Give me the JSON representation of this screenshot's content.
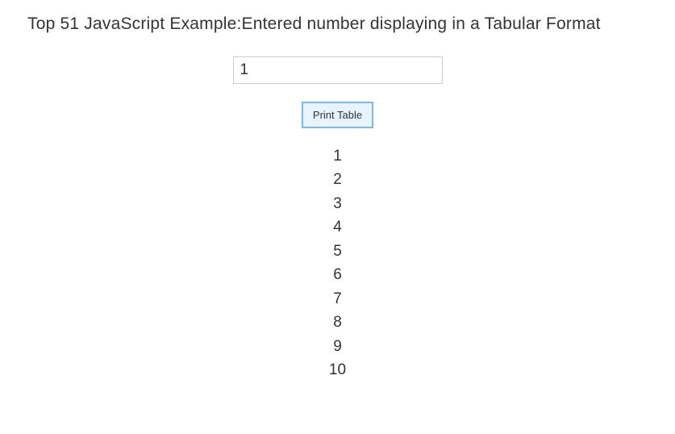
{
  "heading": "Top 51 JavaScript Example:Entered number displaying in a Tabular Format",
  "input": {
    "value": "1"
  },
  "button": {
    "label": "Print Table"
  },
  "results": [
    "1",
    "2",
    "3",
    "4",
    "5",
    "6",
    "7",
    "8",
    "9",
    "10"
  ]
}
